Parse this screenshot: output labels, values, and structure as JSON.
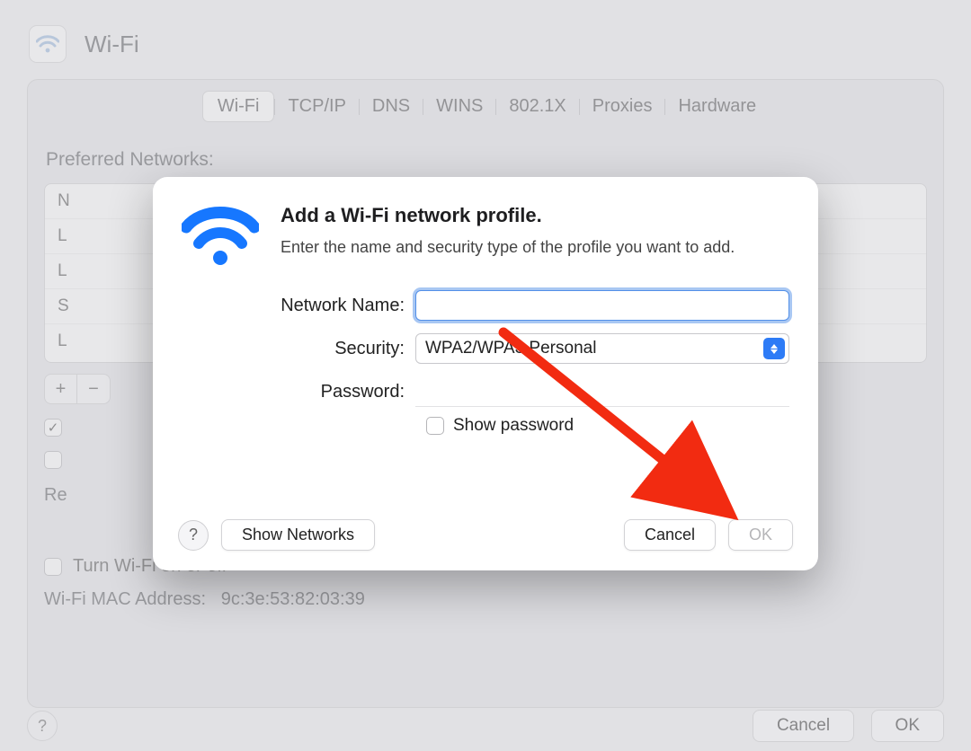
{
  "window": {
    "title": "Wi-Fi",
    "tabs": [
      "Wi-Fi",
      "TCP/IP",
      "DNS",
      "WINS",
      "802.1X",
      "Proxies",
      "Hardware"
    ],
    "selectedTab": 0,
    "preferred_label": "Preferred Networks:",
    "network_rows": [
      "N",
      "L",
      "L",
      "S",
      "L"
    ],
    "add_btn": "+",
    "remove_btn": "−",
    "auto_join_checked": true,
    "auto_join_label": "",
    "require_label": "Re",
    "turn_wifi_label": "Turn Wi-Fi on or off",
    "turn_wifi_checked": false,
    "mac_label": "Wi-Fi MAC Address:",
    "mac_value": "9c:3e:53:82:03:39",
    "footer": {
      "help_glyph": "?",
      "cancel": "Cancel",
      "ok": "OK"
    }
  },
  "modal": {
    "title": "Add a Wi-Fi network profile.",
    "subtitle": "Enter the name and security type of the profile you want to add.",
    "fields": {
      "name_label": "Network Name:",
      "name_value": "",
      "security_label": "Security:",
      "security_value": "WPA2/WPA3 Personal",
      "password_label": "Password:",
      "password_value": "",
      "show_password_label": "Show password",
      "show_password_checked": false
    },
    "footer": {
      "help_glyph": "?",
      "show_networks": "Show Networks",
      "cancel": "Cancel",
      "ok": "OK",
      "ok_disabled": true
    }
  },
  "annotation": {
    "arrow_color": "#f22b11"
  }
}
